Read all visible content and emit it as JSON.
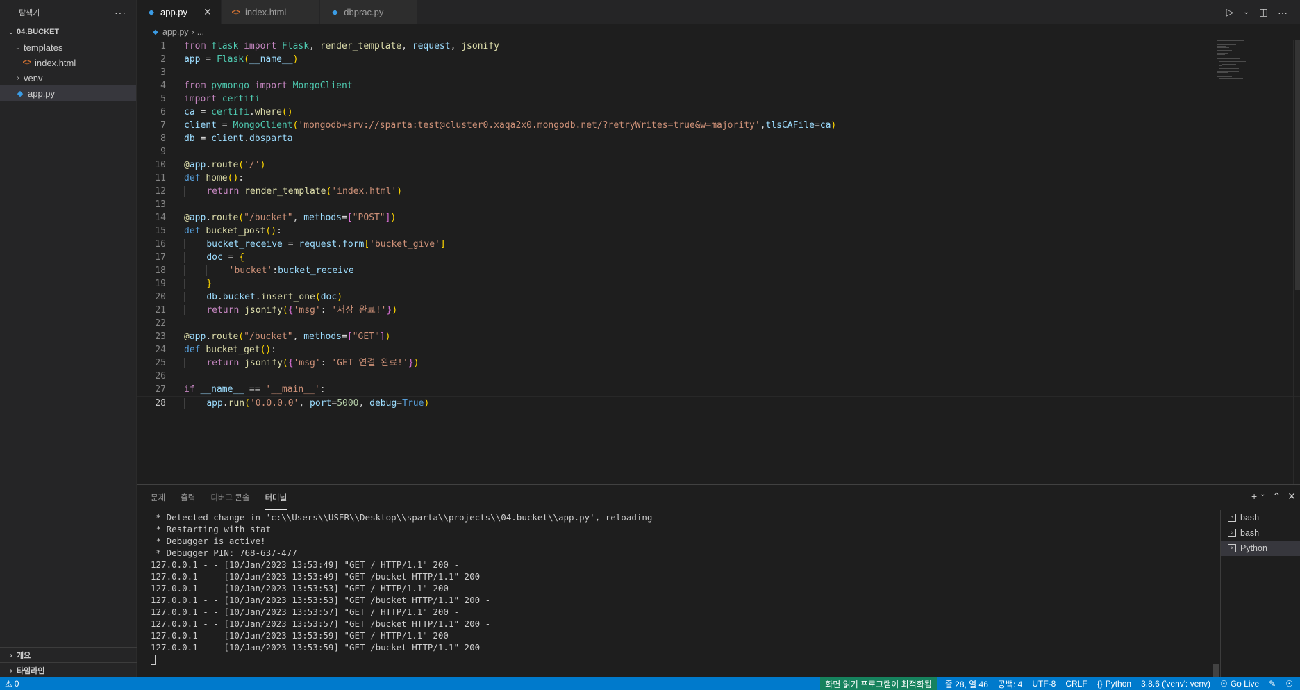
{
  "sidebar": {
    "title": "탐색기",
    "more": "···",
    "section": "04.BUCKET",
    "tree": {
      "templates": "templates",
      "index_html": "index.html",
      "venv": "venv",
      "app_py": "app.py"
    },
    "outline": "개요",
    "timeline": "타임라인"
  },
  "tabs": [
    {
      "label": "app.py",
      "icon": "python-file-icon"
    },
    {
      "label": "index.html",
      "icon": "html-file-icon"
    },
    {
      "label": "dbprac.py",
      "icon": "python-file-icon"
    }
  ],
  "breadcrumb": {
    "file": "app.py",
    "rest": "..."
  },
  "editor": {
    "line_numbers": [
      "1",
      "2",
      "3",
      "4",
      "5",
      "6",
      "7",
      "8",
      "9",
      "10",
      "11",
      "12",
      "13",
      "14",
      "15",
      "16",
      "17",
      "18",
      "19",
      "20",
      "21",
      "22",
      "23",
      "24",
      "25",
      "26",
      "27",
      "28"
    ],
    "current_line": 28
  },
  "code": {
    "from": "from",
    "import": "import",
    "flask": "flask",
    "Flask": "Flask",
    "render_template": "render_template",
    "request": "request",
    "jsonify": "jsonify",
    "app": "app",
    "name": "__name__",
    "pymongo": "pymongo",
    "MongoClient": "MongoClient",
    "certifi": "certifi",
    "ca": "ca",
    "where": "where",
    "client": "client",
    "conn_str": "'mongodb+srv://sparta:test@cluster0.xaqa2x0.mongodb.net/?retryWrites=true&w=majority'",
    "tlsCAFile": "tlsCAFile",
    "db": "db",
    "dbsparta": "dbsparta",
    "route": "route",
    "root_path": "'/'",
    "def": "def",
    "home": "home",
    "return": "return",
    "index_str": "'index.html'",
    "bucket_path": "\"/bucket\"",
    "methods": "methods",
    "post_str": "\"POST\"",
    "get_str": "\"GET\"",
    "bucket_post": "bucket_post",
    "bucket_receive": "bucket_receive",
    "form": "form",
    "bucket_give": "'bucket_give'",
    "doc": "doc",
    "bucket_key": "'bucket'",
    "bucket": "bucket",
    "insert_one": "insert_one",
    "msg_key": "'msg'",
    "msg_saved": "'저장 완료!'",
    "bucket_get": "bucket_get",
    "msg_get": "'GET 연결 완료!'",
    "if": "if",
    "main_str": "'__main__'",
    "run": "run",
    "host": "'0.0.0.0'",
    "port": "port",
    "port_val": "5000",
    "debug": "debug",
    "True": "True"
  },
  "panel": {
    "tabs": [
      "문제",
      "출력",
      "디버그 콘솔",
      "터미널"
    ],
    "active_tab": "터미널",
    "terminal_lines": [
      " * Detected change in 'c:\\\\Users\\\\USER\\\\Desktop\\\\sparta\\\\projects\\\\04.bucket\\\\app.py', reloading",
      " * Restarting with stat",
      " * Debugger is active!",
      " * Debugger PIN: 768-637-477",
      "127.0.0.1 - - [10/Jan/2023 13:53:49] \"GET / HTTP/1.1\" 200 -",
      "127.0.0.1 - - [10/Jan/2023 13:53:49] \"GET /bucket HTTP/1.1\" 200 -",
      "127.0.0.1 - - [10/Jan/2023 13:53:53] \"GET / HTTP/1.1\" 200 -",
      "127.0.0.1 - - [10/Jan/2023 13:53:53] \"GET /bucket HTTP/1.1\" 200 -",
      "127.0.0.1 - - [10/Jan/2023 13:53:57] \"GET / HTTP/1.1\" 200 -",
      "127.0.0.1 - - [10/Jan/2023 13:53:57] \"GET /bucket HTTP/1.1\" 200 -",
      "127.0.0.1 - - [10/Jan/2023 13:53:59] \"GET / HTTP/1.1\" 200 -",
      "127.0.0.1 - - [10/Jan/2023 13:53:59] \"GET /bucket HTTP/1.1\" 200 -"
    ],
    "terminals": [
      "bash",
      "bash",
      "Python"
    ],
    "active_terminal": "Python"
  },
  "statusbar": {
    "problems": "0",
    "screen_reader": "화면 읽기 프로그램이 최적화됨",
    "position": "줄 28, 열 46",
    "spaces": "공백: 4",
    "encoding": "UTF-8",
    "eol": "CRLF",
    "language": "Python",
    "interpreter": "3.8.6 ('venv': venv)",
    "go_live": "Go Live"
  },
  "colors": {
    "status_bar": "#007acc",
    "editor_bg": "#1e1e1e",
    "sidebar_bg": "#252526"
  }
}
